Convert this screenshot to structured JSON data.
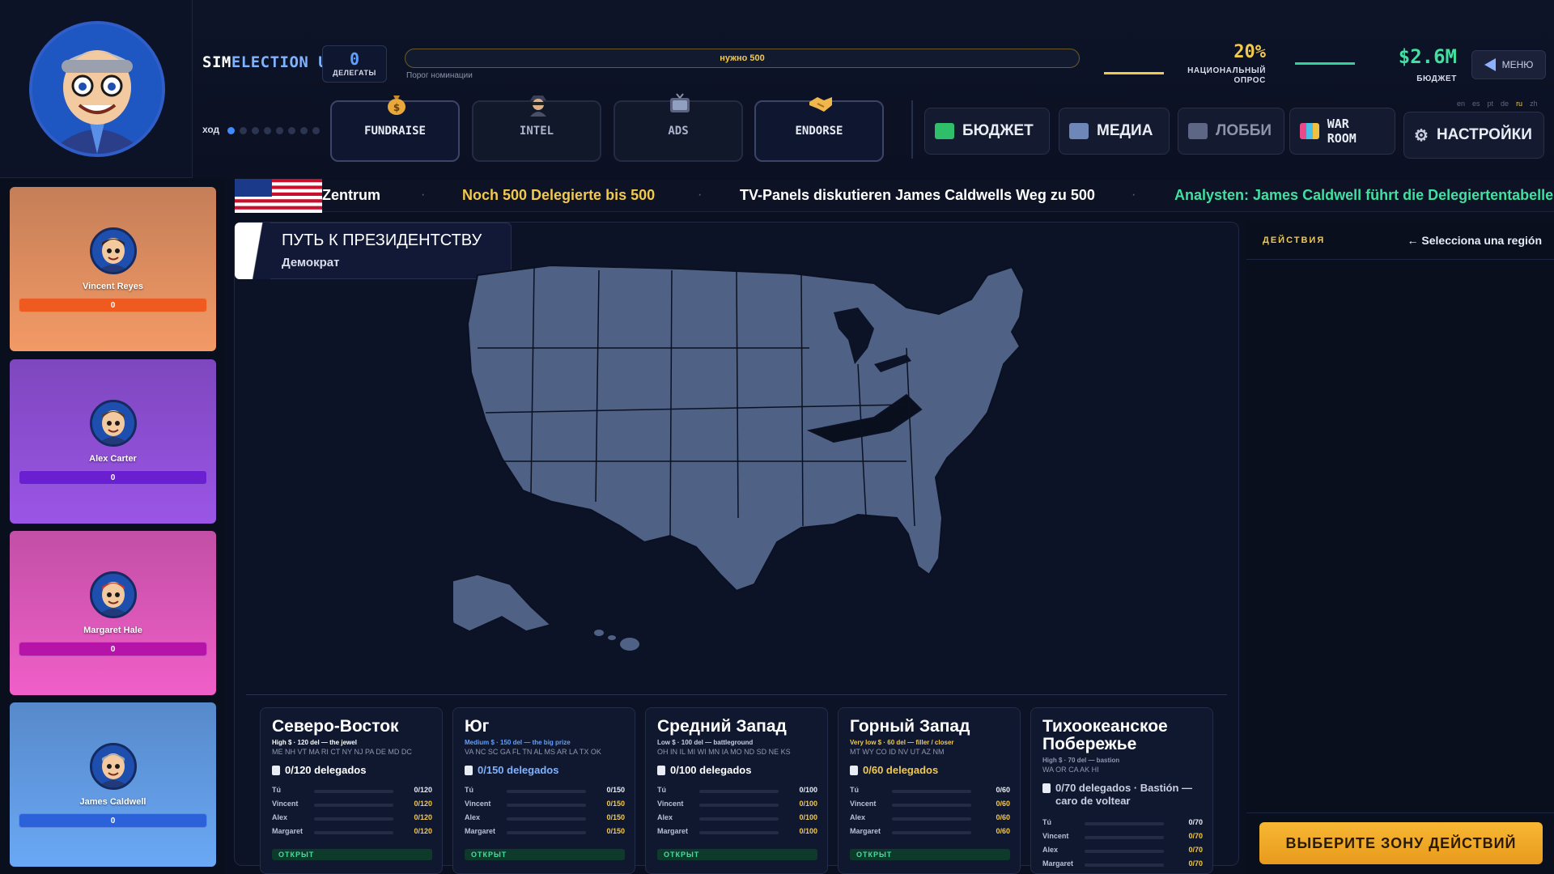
{
  "header": {
    "brand_white": "SIM",
    "brand_blue": "ELECTION",
    "brand_tail": " USA",
    "delegates": {
      "count": "0",
      "label": "ДЕЛЕГАТЫ"
    },
    "threshold": {
      "text": "нужно 500",
      "caption": "Порог номинации"
    },
    "poll": {
      "value": "20%",
      "label_line1": "НАЦИОНАЛЬНЫЙ",
      "label_line2": "ОПРОС"
    },
    "budget": {
      "value": "$2.6M",
      "label": "БЮДЖЕТ"
    },
    "menu_label": "МЕНЮ",
    "turn_label": "ход",
    "turn": {
      "current": 1,
      "total": 8
    },
    "actions": [
      {
        "label": "FUNDRAISE",
        "icon": "money-bag-icon"
      },
      {
        "label": "INTEL",
        "icon": "spy-icon"
      },
      {
        "label": "ADS",
        "icon": "tv-icon"
      },
      {
        "label": "ENDORSE",
        "icon": "handshake-icon"
      }
    ],
    "nav": {
      "budget": "БЮДЖЕТ",
      "media": "МЕДИА",
      "lobby": "ЛОББИ",
      "warroom": "WAR ROOM",
      "settings": "НАСТРОЙКИ"
    },
    "languages": [
      "en",
      "es",
      "pt",
      "de",
      "ru",
      "zh"
    ],
    "active_language": "ru"
  },
  "ticker": {
    "items": [
      {
        "text": "Zentrum",
        "color": "#ffffff"
      },
      {
        "text": "Noch 500 Delegierte bis 500",
        "color": "#f2c94c"
      },
      {
        "text": "TV-Panels diskutieren James Caldwells Weg zu 500",
        "color": "#ffffff"
      },
      {
        "text": "Analysten: James Caldwell führt die Delegiertentabelle",
        "color": "#3fe0a0"
      }
    ]
  },
  "candidates": [
    {
      "name": "Vincent Reyes",
      "value": "0",
      "bg": "#f39a66",
      "bar": "#ef5a1f"
    },
    {
      "name": "Alex Carter",
      "value": "0",
      "bg": "#9b55e6",
      "bar": "#6a1fd0"
    },
    {
      "name": "Margaret Hale",
      "value": "0",
      "bg": "#f05fc8",
      "bar": "#b614a8"
    },
    {
      "name": "James Caldwell",
      "value": "0",
      "bg": "#6aa8f5",
      "bar": "#2b62d9"
    }
  ],
  "map": {
    "title": "ПУТЬ К ПРЕЗИДЕНТСТВУ",
    "subtitle": "Демократ"
  },
  "regions": [
    {
      "name": "Северо-Восток",
      "meta": "High $ · 120 del — the jewel",
      "meta_color": "#ffffff",
      "states": "ME NH VT MA RI CT NY NJ PA DE MD DC",
      "delegates_text": "0/120 delegados",
      "delegates_color": "#ffffff",
      "rows": [
        {
          "name": "Tú",
          "value": "0/120"
        },
        {
          "name": "Vincent",
          "value": "0/120"
        },
        {
          "name": "Alex",
          "value": "0/120"
        },
        {
          "name": "Margaret",
          "value": "0/120"
        }
      ],
      "status": "ОТКРЫТ"
    },
    {
      "name": "Юг",
      "meta": "Medium $ · 150 del — the big prize",
      "meta_color": "#5fa0ff",
      "states": "VA NC SC GA FL TN AL MS AR LA TX OK",
      "delegates_text": "0/150 delegados",
      "delegates_color": "#7fb2ff",
      "rows": [
        {
          "name": "Tú",
          "value": "0/150"
        },
        {
          "name": "Vincent",
          "value": "0/150"
        },
        {
          "name": "Alex",
          "value": "0/150"
        },
        {
          "name": "Margaret",
          "value": "0/150"
        }
      ],
      "status": "ОТКРЫТ"
    },
    {
      "name": "Средний Запад",
      "meta": "Low $ · 100 del — battleground",
      "meta_color": "#c9cfe0",
      "states": "OH IN IL MI WI MN IA MO ND SD NE KS",
      "delegates_text": "0/100 delegados",
      "delegates_color": "#ffffff",
      "rows": [
        {
          "name": "Tú",
          "value": "0/100"
        },
        {
          "name": "Vincent",
          "value": "0/100"
        },
        {
          "name": "Alex",
          "value": "0/100"
        },
        {
          "name": "Margaret",
          "value": "0/100"
        }
      ],
      "status": "ОТКРЫТ"
    },
    {
      "name": "Горный Запад",
      "meta": "Very low $ · 60 del — filler / closer",
      "meta_color": "#f2c94c",
      "states": "MT WY CO ID NV UT AZ NM",
      "delegates_text": "0/60 delegados",
      "delegates_color": "#f2c94c",
      "rows": [
        {
          "name": "Tú",
          "value": "0/60"
        },
        {
          "name": "Vincent",
          "value": "0/60"
        },
        {
          "name": "Alex",
          "value": "0/60"
        },
        {
          "name": "Margaret",
          "value": "0/60"
        }
      ],
      "status": "ОТКРЫТ"
    },
    {
      "name": "Тихоокеанское Побережье",
      "meta": "High $ · 70 del — bastion",
      "meta_color": "#8f97b0",
      "states": "WA OR CA AK HI",
      "delegates_text": "0/70 delegados · Bastión — caro de voltear",
      "delegates_color": "#c9cfe0",
      "rows": [
        {
          "name": "Tú",
          "value": "0/70"
        },
        {
          "name": "Vincent",
          "value": "0/70"
        },
        {
          "name": "Alex",
          "value": "0/70"
        },
        {
          "name": "Margaret",
          "value": "0/70"
        }
      ],
      "status": ""
    }
  ],
  "actions_panel": {
    "title": "ДЕЙСТВИЯ",
    "hint": "← Selecciona una región",
    "cta": "ВЫБЕРИТЕ ЗОНУ ДЕЙСТВИЙ"
  },
  "colors": {
    "accent_gold": "#f2c94c",
    "accent_blue": "#3f8cff",
    "accent_green": "#3fe0a0",
    "map_fill": "#4f6185",
    "map_stroke": "#0b1122"
  }
}
